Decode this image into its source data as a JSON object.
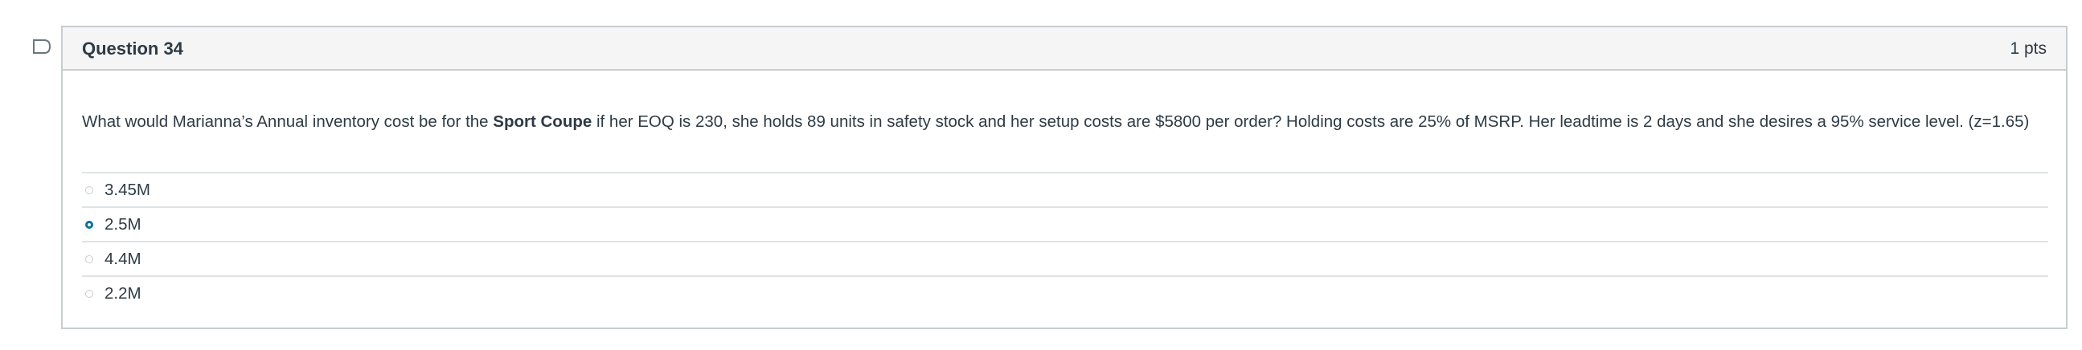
{
  "question": {
    "title": "Question 34",
    "points": "1 pts",
    "text_before": "What would Marianna’s Annual inventory cost be for the ",
    "text_bold": "Sport Coupe",
    "text_after": " if her EOQ is 230, she holds 89 units in safety stock and her setup costs are $5800 per order?  Holding costs are 25% of MSRP. Her leadtime is 2 days and she desires a 95% service level.  (z=1.65)",
    "answers": [
      {
        "label": "3.45M",
        "selected": false
      },
      {
        "label": "2.5M",
        "selected": true
      },
      {
        "label": "4.4M",
        "selected": false
      },
      {
        "label": "2.2M",
        "selected": false
      }
    ]
  },
  "icons": {
    "flag": "flag-question-icon",
    "radio_selected_color": "#0770a3"
  }
}
